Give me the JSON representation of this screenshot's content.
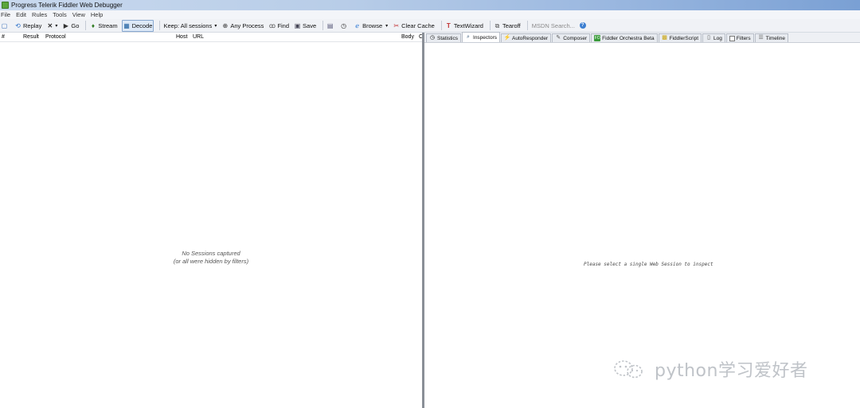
{
  "window": {
    "title": "Progress Telerik Fiddler Web Debugger"
  },
  "menu": {
    "items": [
      "File",
      "Edit",
      "Rules",
      "Tools",
      "View",
      "Help"
    ]
  },
  "toolbar": {
    "replay": "Replay",
    "go": "Go",
    "stream": "Stream",
    "decode": "Decode",
    "keep": "Keep: All sessions",
    "any_process": "Any Process",
    "find": "Find",
    "save": "Save",
    "browse": "Browse",
    "clear_cache": "Clear Cache",
    "text_wizard": "TextWizard",
    "tearoff": "Tearoff",
    "msdn_search": "MSDN Search..."
  },
  "sessions": {
    "columns": {
      "num": "#",
      "result": "Result",
      "protocol": "Protocol",
      "host": "Host",
      "url": "URL",
      "body": "Body",
      "caching": "C"
    },
    "empty_line1": "No Sessions captured",
    "empty_line2": "(or all were hidden by filters)"
  },
  "tabs": {
    "items": [
      {
        "label": "Statistics",
        "icon": "stopwatch-icon"
      },
      {
        "label": "Inspectors",
        "icon": "inspect-icon",
        "active": true
      },
      {
        "label": "AutoResponder",
        "icon": "lightning-icon"
      },
      {
        "label": "Composer",
        "icon": "pencil-icon"
      },
      {
        "label": "Fiddler Orchestra Beta",
        "icon": "fo-icon"
      },
      {
        "label": "FiddlerScript",
        "icon": "script-icon"
      },
      {
        "label": "Log",
        "icon": "log-icon"
      },
      {
        "label": "Filters",
        "icon": "checkbox-icon"
      },
      {
        "label": "Timeline",
        "icon": "timeline-icon"
      }
    ]
  },
  "inspector": {
    "message": "Please select a single Web Session to inspect"
  },
  "watermark": {
    "text": "python学习爱好者"
  }
}
